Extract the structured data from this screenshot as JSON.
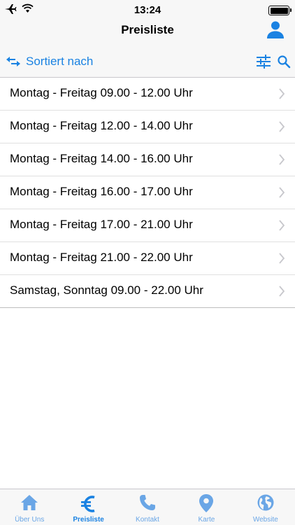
{
  "status": {
    "time": "13:24"
  },
  "navbar": {
    "title": "Preisliste"
  },
  "sortbar": {
    "label": "Sortiert nach"
  },
  "list": {
    "items": [
      "Montag - Freitag 09.00 - 12.00 Uhr",
      "Montag - Freitag 12.00 - 14.00 Uhr",
      "Montag - Freitag 14.00 - 16.00 Uhr",
      "Montag - Freitag 16.00 - 17.00 Uhr",
      "Montag - Freitag 17.00 - 21.00 Uhr",
      "Montag - Freitag 21.00 - 22.00 Uhr",
      "Samstag, Sonntag 09.00 - 22.00 Uhr"
    ]
  },
  "tabs": [
    {
      "label": "Über Uns",
      "icon": "home-icon"
    },
    {
      "label": "Preisliste",
      "icon": "euro-icon",
      "active": true
    },
    {
      "label": "Kontakt",
      "icon": "phone-icon"
    },
    {
      "label": "Karte",
      "icon": "map-pin-icon"
    },
    {
      "label": "Website",
      "icon": "globe-icon"
    }
  ],
  "colors": {
    "accent": "#1a82e2",
    "tab_inactive": "#6aa6e6",
    "bar_bg": "#f7f7f7",
    "separator": "#e0e0e0"
  }
}
